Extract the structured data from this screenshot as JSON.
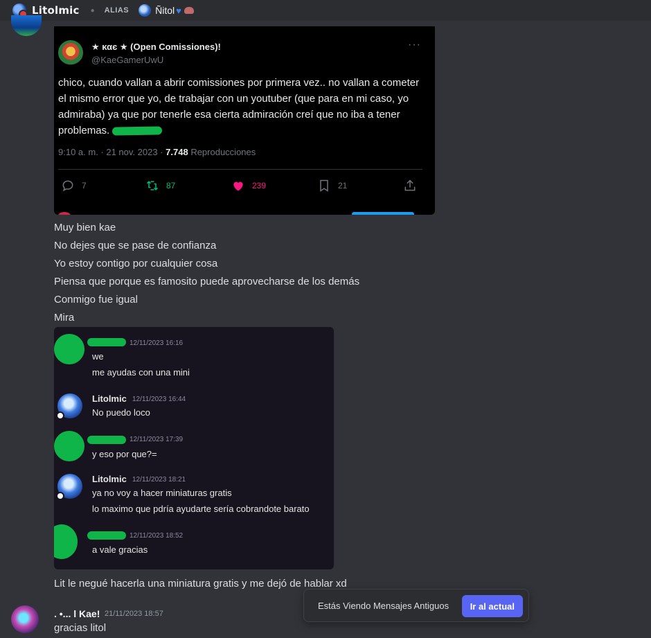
{
  "header": {
    "username": "Litolmic",
    "alias_label": "ALIAS",
    "nickname": "Ñitol"
  },
  "tweet": {
    "display_name": "★ καє ★ (Open Comissiones)!",
    "handle": "@KaeGamerUwU",
    "text": "chico, cuando vallan a abrir comissiones por primera vez.. no vallan a cometer el mismo error que yo, de trabajar con un youtuber (que para en mi caso, yo admiraba) ya que por tenerle esa cierta admiración creí que no iba a tener problemas.",
    "time": "9:10 a. m. · 21 nov. 2023 ·",
    "views": "7.748",
    "views_label": "Reproducciones",
    "replies": "7",
    "retweets": "87",
    "likes": "239",
    "bookmarks": "21"
  },
  "messages": [
    "Muy bien kae",
    "No dejes que se pase de confianza",
    "Yo estoy contigo por cualquier cosa",
    "Piensa que porque es famosito puede aprovecharse de los demás",
    "Conmigo fue igual",
    "Mira"
  ],
  "chat": {
    "m1_time": "12/11/2023 16:16",
    "m1_text1": "we",
    "m1_text2": "me ayudas con una mini",
    "m2_name": "Litolmic",
    "m2_time": "12/11/2023 16:44",
    "m2_text": "No puedo loco",
    "m3_time": "12/11/2023 17:39",
    "m3_text": "y eso por que?=",
    "m4_name": "Litolmic",
    "m4_time": "12/11/2023 18:21",
    "m4_text1": "ya no voy a hacer miniaturas gratis",
    "m4_text2": "lo maximo que pdría ayudarte sería cobrandote barato",
    "m5_time": "12/11/2023 18:52",
    "m5_text": "a vale gracias"
  },
  "after_chat": "Lit le negué hacerla una miniatura gratis y me dejó de hablar xd",
  "bottom_message": {
    "author": ". •... l Kae!",
    "time": "21/11/2023 18:57",
    "text": "gracias litol"
  },
  "old_messages_bar": {
    "text": "Estás Viendo Mensajes Antiguos",
    "button": "Ir al actual"
  }
}
